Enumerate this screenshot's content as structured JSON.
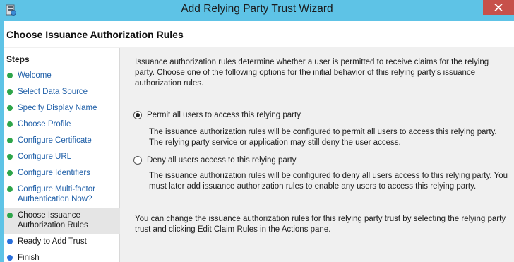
{
  "window": {
    "title": "Add Relying Party Trust Wizard",
    "app_icon": "wizard-server-icon",
    "close_icon": "close-icon"
  },
  "header": {
    "title": "Choose Issuance Authorization Rules"
  },
  "steps": {
    "title": "Steps",
    "items": [
      {
        "label": "Welcome",
        "state": "completed"
      },
      {
        "label": "Select Data Source",
        "state": "completed"
      },
      {
        "label": "Specify Display Name",
        "state": "completed"
      },
      {
        "label": "Choose Profile",
        "state": "completed"
      },
      {
        "label": "Configure Certificate",
        "state": "completed"
      },
      {
        "label": "Configure URL",
        "state": "completed"
      },
      {
        "label": "Configure Identifiers",
        "state": "completed"
      },
      {
        "label": "Configure Multi-factor Authentication Now?",
        "state": "completed"
      },
      {
        "label": "Choose Issuance Authorization Rules",
        "state": "current"
      },
      {
        "label": "Ready to Add Trust",
        "state": "pending"
      },
      {
        "label": "Finish",
        "state": "pending"
      }
    ]
  },
  "main": {
    "intro": "Issuance authorization rules determine whether a user is permitted to receive claims for the relying party. Choose one of the following options for the initial behavior of this relying party's issuance authorization rules.",
    "options": [
      {
        "label": "Permit all users to access this relying party",
        "selected": true,
        "description": "The issuance authorization rules will be configured to permit all users to access this relying party. The relying party service or application may still deny the user access."
      },
      {
        "label": "Deny all users access to this relying party",
        "selected": false,
        "description": "The issuance authorization rules will be configured to deny all users access to this relying party. You must later add issuance authorization rules to enable any users to access this relying party."
      }
    ],
    "footer_note": "You can change the issuance authorization rules for this relying party trust by selecting the relying party trust and clicking Edit Claim Rules in the Actions pane."
  },
  "colors": {
    "titlebar": "#5ec3e6",
    "close_button": "#c7504a",
    "step_completed_dot": "#2ea54a",
    "step_pending_dot": "#2a6fdb",
    "step_link_text": "#1f5fa8"
  }
}
